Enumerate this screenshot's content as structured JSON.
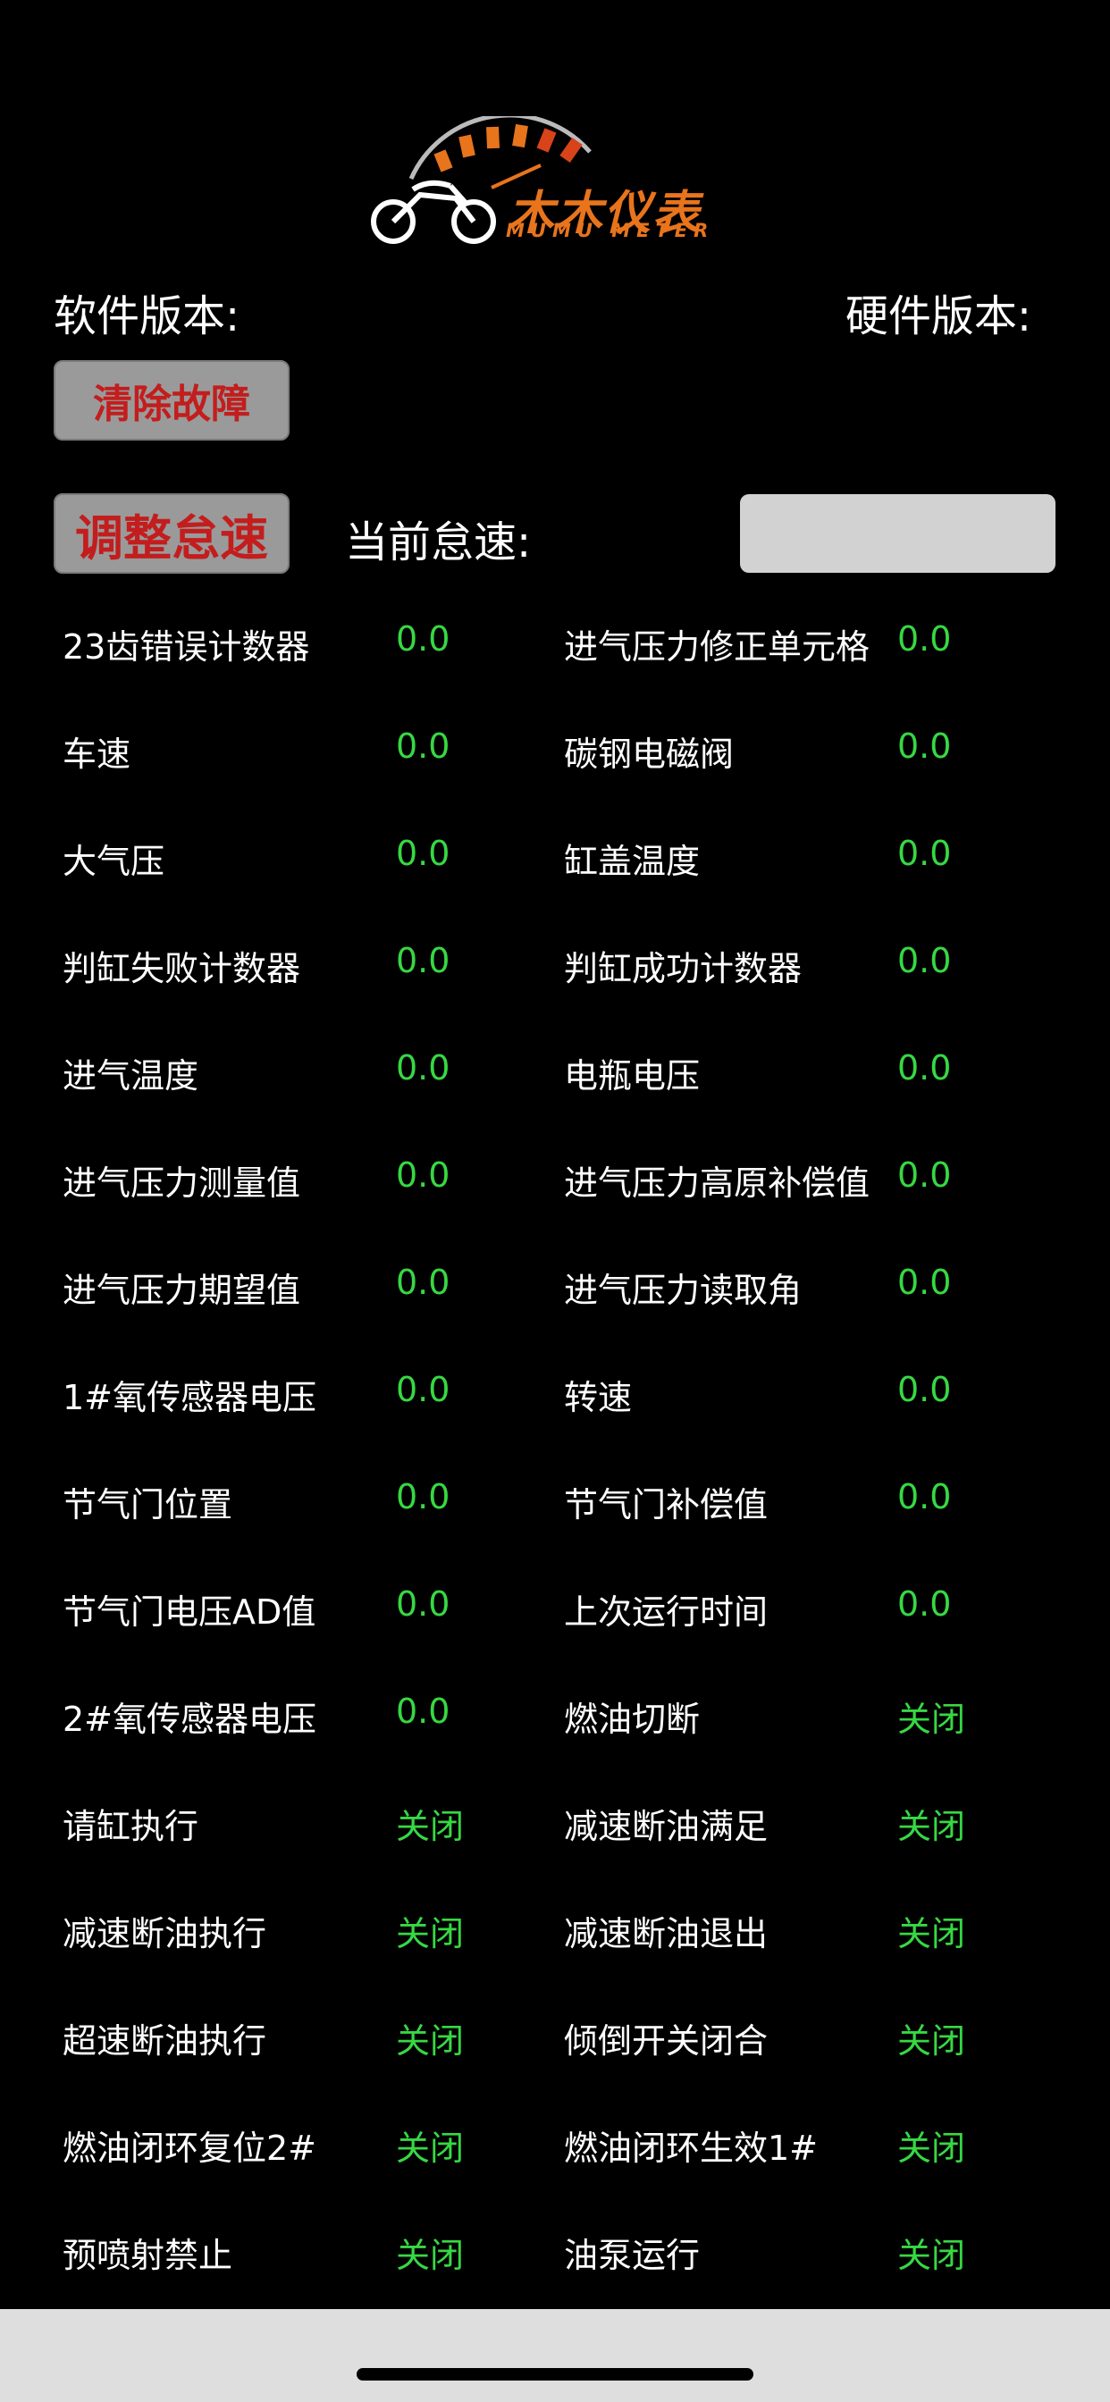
{
  "logo": {
    "cn": "木木仪表",
    "en": "MUMU METER"
  },
  "header": {
    "software_version_label": "软件版本:",
    "hardware_version_label": "硬件版本:"
  },
  "actions": {
    "clear_fault_label": "清除故障",
    "adjust_idle_label": "调整怠速",
    "current_idle_label": "当前怠速:",
    "current_idle_value": ""
  },
  "colors": {
    "value_green": "#37d843",
    "button_red": "#c31d1d",
    "logo_orange": "#e8741c"
  },
  "rows": [
    {
      "left": {
        "label": "23齿错误计数器",
        "value": "0.0"
      },
      "right": {
        "label": "进气压力修正单元格",
        "value": "0.0"
      }
    },
    {
      "left": {
        "label": "车速",
        "value": "0.0"
      },
      "right": {
        "label": "碳钢电磁阀",
        "value": "0.0"
      }
    },
    {
      "left": {
        "label": "大气压",
        "value": "0.0"
      },
      "right": {
        "label": "缸盖温度",
        "value": "0.0"
      }
    },
    {
      "left": {
        "label": "判缸失败计数器",
        "value": "0.0"
      },
      "right": {
        "label": "判缸成功计数器",
        "value": "0.0"
      }
    },
    {
      "left": {
        "label": "进气温度",
        "value": "0.0"
      },
      "right": {
        "label": "电瓶电压",
        "value": "0.0"
      }
    },
    {
      "left": {
        "label": "进气压力测量值",
        "value": "0.0"
      },
      "right": {
        "label": "进气压力高原补偿值",
        "value": "0.0"
      }
    },
    {
      "left": {
        "label": "进气压力期望值",
        "value": "0.0"
      },
      "right": {
        "label": "进气压力读取角",
        "value": "0.0"
      }
    },
    {
      "left": {
        "label": "1#氧传感器电压",
        "value": "0.0"
      },
      "right": {
        "label": "转速",
        "value": "0.0"
      }
    },
    {
      "left": {
        "label": "节气门位置",
        "value": "0.0"
      },
      "right": {
        "label": "节气门补偿值",
        "value": "0.0"
      }
    },
    {
      "left": {
        "label": "节气门电压AD值",
        "value": "0.0"
      },
      "right": {
        "label": "上次运行时间",
        "value": "0.0"
      }
    },
    {
      "left": {
        "label": "2#氧传感器电压",
        "value": "0.0"
      },
      "right": {
        "label": "燃油切断",
        "value": "关闭"
      }
    },
    {
      "left": {
        "label": "请缸执行",
        "value": "关闭"
      },
      "right": {
        "label": "减速断油满足",
        "value": "关闭"
      }
    },
    {
      "left": {
        "label": "减速断油执行",
        "value": "关闭"
      },
      "right": {
        "label": "减速断油退出",
        "value": "关闭"
      }
    },
    {
      "left": {
        "label": "超速断油执行",
        "value": "关闭"
      },
      "right": {
        "label": "倾倒开关闭合",
        "value": "关闭"
      }
    },
    {
      "left": {
        "label": "燃油闭环复位2#",
        "value": "关闭"
      },
      "right": {
        "label": "燃油闭环生效1#",
        "value": "关闭"
      }
    },
    {
      "left": {
        "label": "预喷射禁止",
        "value": "关闭"
      },
      "right": {
        "label": "油泵运行",
        "value": "关闭"
      }
    }
  ]
}
